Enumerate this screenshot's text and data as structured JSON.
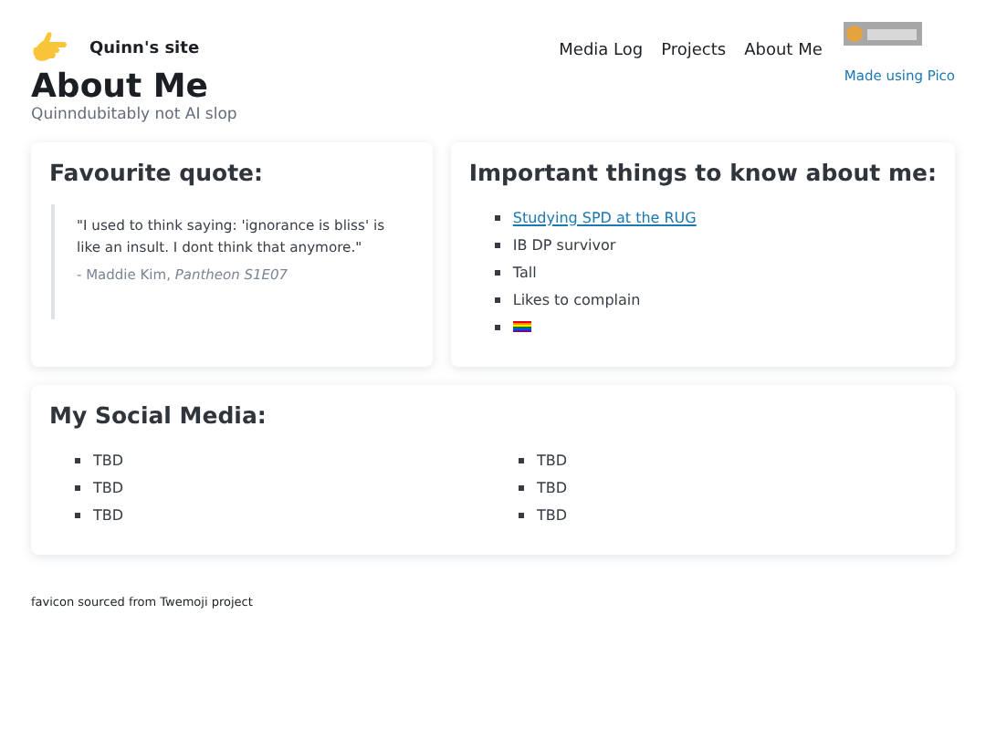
{
  "header": {
    "site_name": "Quinn's site",
    "nav": [
      "Media Log",
      "Projects",
      "About Me"
    ],
    "credit_link": "Made using Pico"
  },
  "page": {
    "title": "About Me",
    "subtitle": "Quinndubitably not AI slop"
  },
  "quote_card": {
    "heading": "Favourite quote:",
    "quote": "\"I used to think saying: 'ignorance is bliss' is like an insult. I dont think that anymore.\"",
    "attribution": "- Maddie Kim, *Pantheon S1E07*"
  },
  "facts_card": {
    "heading": "Important things to know about me:",
    "items": [
      {
        "kind": "link",
        "text": "Studying SPD at the RUG"
      },
      {
        "kind": "text",
        "text": "IB DP survivor"
      },
      {
        "kind": "text",
        "text": "Tall"
      },
      {
        "kind": "text",
        "text": "Likes to complain"
      },
      {
        "kind": "flag"
      }
    ]
  },
  "social_card": {
    "heading": "My Social Media:",
    "columns": [
      [
        "TBD",
        "TBD",
        "TBD"
      ],
      [
        "TBD",
        "TBD",
        "TBD"
      ]
    ]
  },
  "footer": "favicon sourced from Twemoji project"
}
